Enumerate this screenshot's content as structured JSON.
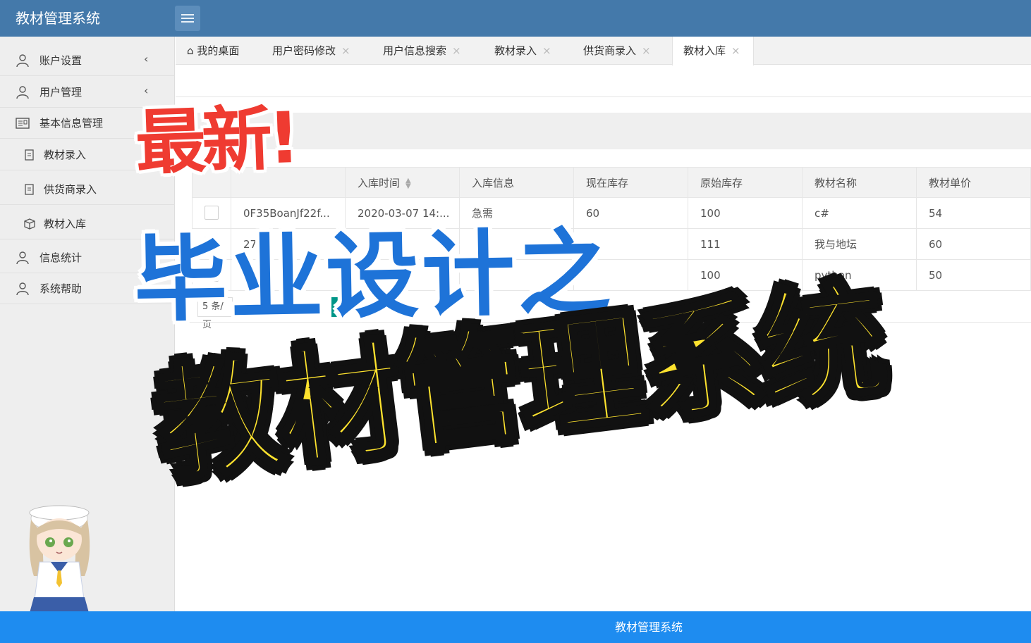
{
  "header": {
    "app_title": "教材管理系统"
  },
  "sidebar": {
    "items": [
      {
        "label": "账户设置",
        "icon": "user-icon",
        "has_chevron": true
      },
      {
        "label": "用户管理",
        "icon": "user-icon",
        "has_chevron": true
      },
      {
        "label": "基本信息管理",
        "icon": "info-card-icon",
        "has_chevron": false
      },
      {
        "label": "教材录入",
        "icon": "document-icon",
        "sub": true
      },
      {
        "label": "供货商录入",
        "icon": "document-icon",
        "sub": true
      },
      {
        "label": "教材入库",
        "icon": "box-icon",
        "sub": true
      },
      {
        "label": "信息统计",
        "icon": "user-icon",
        "has_chevron": false
      },
      {
        "label": "系统帮助",
        "icon": "user-icon",
        "has_chevron": false
      }
    ]
  },
  "tabs": [
    {
      "label": "我的桌面",
      "icon": "home-icon",
      "closable": false
    },
    {
      "label": "用户密码修改",
      "closable": true
    },
    {
      "label": "用户信息搜索",
      "closable": true
    },
    {
      "label": "教材录入",
      "closable": true
    },
    {
      "label": "供货商录入",
      "closable": true
    },
    {
      "label": "教材入库",
      "closable": true,
      "active": true
    }
  ],
  "table": {
    "columns": [
      "入库时间",
      "入库信息",
      "现在库存",
      "原始库存",
      "教材名称",
      "教材单价"
    ],
    "rows": [
      {
        "id": "0F35BoanJf22f...",
        "time": "2020-03-07 14:...",
        "info": "急需",
        "current": "60",
        "original": "100",
        "name": "c#",
        "price": "54"
      },
      {
        "id": "27",
        "time": "",
        "info": "",
        "current": "",
        "original": "111",
        "name": "我与地坛",
        "price": "60"
      },
      {
        "id": "",
        "time": "",
        "info": "",
        "current": "",
        "original": "100",
        "name": "python",
        "price": "50"
      }
    ]
  },
  "pager": {
    "page_size": "5 条/页",
    "current_page": "1"
  },
  "footer": {
    "text": "教材管理系统"
  },
  "overlay": {
    "line1": "最新!",
    "line2": "毕业设计之",
    "line3": "教材管理系统"
  },
  "colors": {
    "header": "#4479aa",
    "footer": "#1e8cf0",
    "overlay_red": "#ef3b31",
    "overlay_blue": "#1e73d8",
    "overlay_yellow": "#fde22e"
  }
}
